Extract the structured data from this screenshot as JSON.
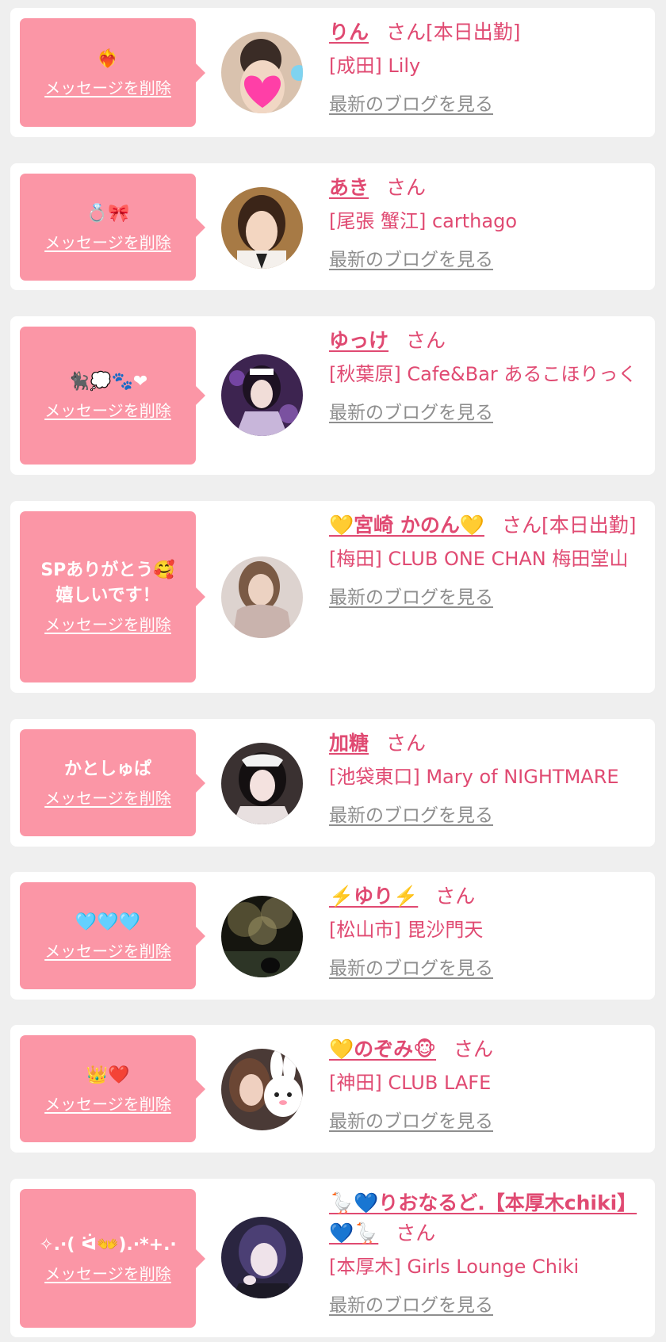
{
  "ui": {
    "delete_label": "メッセージを削除",
    "blog_label": "最新のブログを見る",
    "honorific": "さん"
  },
  "colors": {
    "page_bg": "#efefef",
    "card_bg": "#ffffff",
    "bubble_bg": "#fb96a6",
    "accent_text": "#e04a72",
    "link_gray": "#8e8e8e"
  },
  "messages": [
    {
      "message": "❤️‍🔥",
      "name": "りん",
      "status": "[本日出勤]",
      "shop": "[成田] Lily",
      "avatar_icon": "avatar-photo-heart-sticker"
    },
    {
      "message": "💍🎀",
      "name": "あき",
      "status": "",
      "shop": "[尾張 蟹江] carthago",
      "avatar_icon": "avatar-photo"
    },
    {
      "message": "🐈‍⬛💭🐾❤",
      "name": "ゆっけ",
      "status": "",
      "shop": "[秋葉原] Cafe&Bar あるこほりっく",
      "avatar_icon": "avatar-photo"
    },
    {
      "message": "SPありがとう🥰\n嬉しいです！",
      "name": "💛宮崎 かのん💛",
      "status": "[本日出勤]",
      "shop": "[梅田] CLUB ONE CHAN 梅田堂山",
      "avatar_icon": "avatar-photo"
    },
    {
      "message": "かとしゅぱ",
      "name": "加糖",
      "status": "",
      "shop": "[池袋東口] Mary of NIGHTMARE",
      "avatar_icon": "avatar-photo"
    },
    {
      "message": "🩵🩵🩵",
      "name": "⚡️ゆり⚡️",
      "status": "",
      "shop": "[松山市] 毘沙門天",
      "avatar_icon": "avatar-photo-night-trees"
    },
    {
      "message": "👑❤️",
      "name": "💛のぞみ🐵",
      "status": "",
      "shop": "[神田] CLUB LAFE",
      "avatar_icon": "avatar-photo-bunny-sticker"
    },
    {
      "message": "✧.·( ᐛ👐).·*+.·",
      "name": "🪿💙りおなるど.【本厚木chiki】💙🪿",
      "status": "",
      "shop": "[本厚木] Girls Lounge Chiki",
      "avatar_icon": "avatar-photo"
    }
  ]
}
